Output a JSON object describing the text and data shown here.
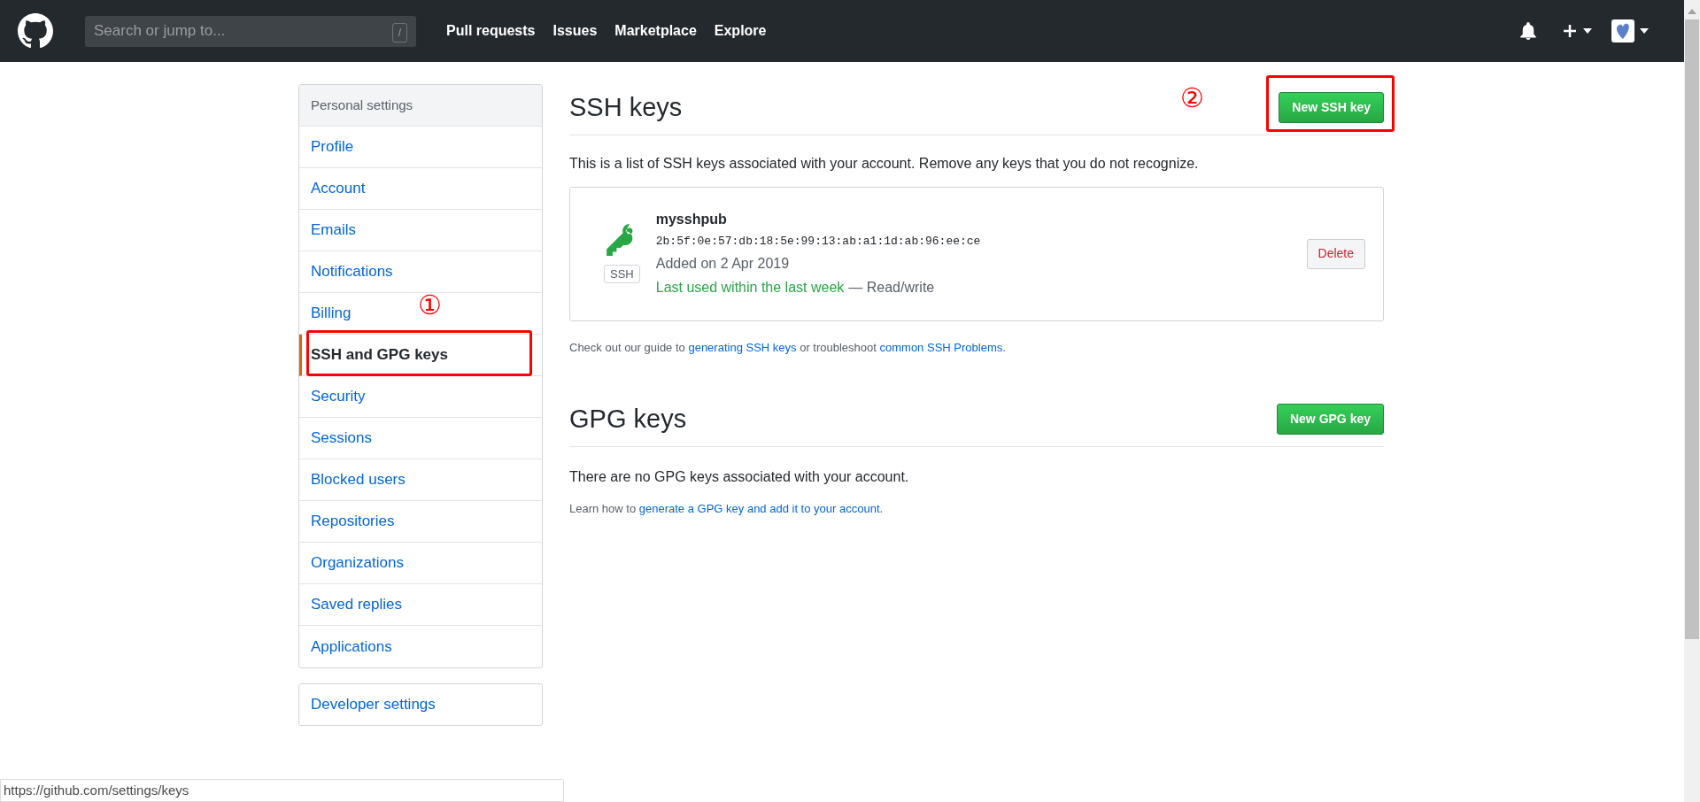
{
  "header": {
    "search": {
      "placeholder": "Search or jump to...",
      "shortcut": "/"
    },
    "nav": [
      "Pull requests",
      "Issues",
      "Marketplace",
      "Explore"
    ]
  },
  "sidebar": {
    "title": "Personal settings",
    "items": [
      {
        "label": "Profile",
        "selected": false
      },
      {
        "label": "Account",
        "selected": false
      },
      {
        "label": "Emails",
        "selected": false
      },
      {
        "label": "Notifications",
        "selected": false
      },
      {
        "label": "Billing",
        "selected": false
      },
      {
        "label": "SSH and GPG keys",
        "selected": true
      },
      {
        "label": "Security",
        "selected": false
      },
      {
        "label": "Sessions",
        "selected": false
      },
      {
        "label": "Blocked users",
        "selected": false
      },
      {
        "label": "Repositories",
        "selected": false
      },
      {
        "label": "Organizations",
        "selected": false
      },
      {
        "label": "Saved replies",
        "selected": false
      },
      {
        "label": "Applications",
        "selected": false
      }
    ],
    "extra_items": [
      "Developer settings"
    ]
  },
  "ssh": {
    "title": "SSH keys",
    "new_button": "New SSH key",
    "description": "This is a list of SSH keys associated with your account. Remove any keys that you do not recognize.",
    "keys": [
      {
        "badge": "SSH",
        "name": "mysshpub",
        "fingerprint": "2b:5f:0e:57:db:18:5e:99:13:ab:a1:1d:ab:96:ee:ce",
        "added": "Added on 2 Apr 2019",
        "last_used": "Last used within the last week",
        "access": "— Read/write",
        "delete_button": "Delete"
      }
    ],
    "help": {
      "before": "Check out our guide to ",
      "link1": "generating SSH keys",
      "middle": " or troubleshoot ",
      "link2": "common SSH Problems",
      "after": "."
    }
  },
  "gpg": {
    "title": "GPG keys",
    "new_button": "New GPG key",
    "empty": "There are no GPG keys associated with your account.",
    "help": {
      "before": "Learn how to ",
      "link": "generate a GPG key and add it to your account",
      "after": "."
    }
  },
  "annotations": [
    "①",
    "②"
  ],
  "status_bar": {
    "url": "https://github.com/settings/keys"
  }
}
